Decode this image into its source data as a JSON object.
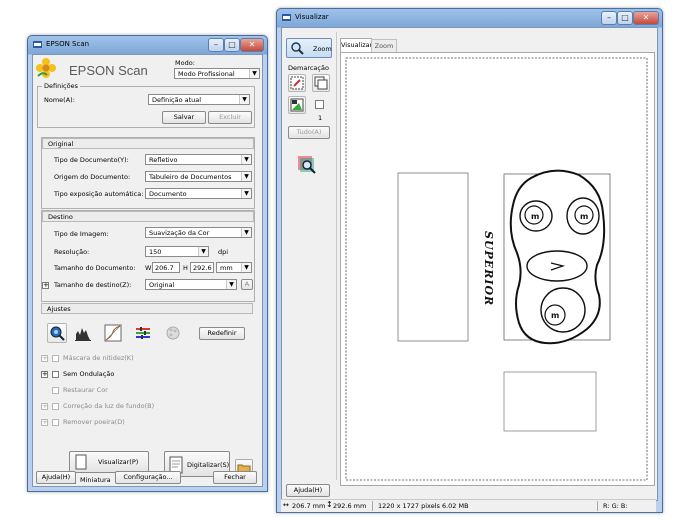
{
  "left_window": {
    "title": "EPSON Scan",
    "brand": "EPSON Scan",
    "mode_label": "Modo:",
    "mode_value": "Modo Profissional",
    "definicoes": {
      "header": "Definições",
      "name_label": "Nome(A):",
      "name_value": "Definição atual",
      "save": "Salvar",
      "delete": "Excluir"
    },
    "original": {
      "header": "Original",
      "doc_type_label": "Tipo de Documento(Y):",
      "doc_type_value": "Refletivo",
      "source_label": "Origem do Documento:",
      "source_value": "Tabuleiro de Documentos",
      "exposure_label": "Tipo exposição automática:",
      "exposure_value": "Documento"
    },
    "destino": {
      "header": "Destino",
      "image_type_label": "Tipo de Imagem:",
      "image_type_value": "Suavização da Cor",
      "resolution_label": "Resolução:",
      "resolution_value": "150",
      "dpi": "dpi",
      "doc_size_label": "Tamanho do Documento:",
      "w": "W",
      "w_value": "206.7",
      "h": "H",
      "h_value": "292.6",
      "unit": "mm",
      "target_size_label": "Tamanho de destino(Z):",
      "target_size_value": "Original"
    },
    "ajustes": {
      "header": "Ajustes",
      "reset": "Redefinir",
      "options": [
        {
          "label": "Máscara de nitidez(K)",
          "enabled": false
        },
        {
          "label": "Sem Ondulação",
          "enabled": true
        },
        {
          "label": "Restaurar Cor",
          "enabled": false
        },
        {
          "label": "Correção da luz de fundo(B)",
          "enabled": false
        },
        {
          "label": "Remover poeira(D)",
          "enabled": false
        }
      ]
    },
    "preview_button": "Visualizar(P)",
    "scan_button": "Digitalizar(S)",
    "thumbnail_label": "Miniatura",
    "help": "Ajuda(H)",
    "config": "Configuração...",
    "close": "Fechar"
  },
  "right_window": {
    "title": "Visualizar",
    "zoom_tool": "Zoom",
    "tabs": [
      "Visualizar",
      "Zoom"
    ],
    "marquee_label": "Demarcação",
    "marquee_count": "1",
    "all_button": "Tudo(A)",
    "help": "Ajuda(H)",
    "doc_text": "SUPERIOR",
    "status": {
      "width": "206.7 mm",
      "height": "292.6 mm",
      "pixels": "1220 x 1727 pixels 6.02 MB",
      "rgb": "R: G: B:"
    }
  }
}
